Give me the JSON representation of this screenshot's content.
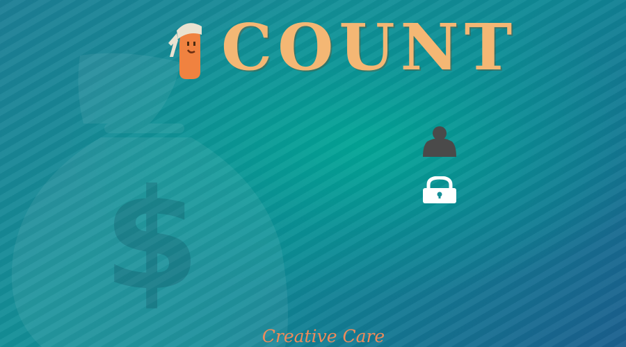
{
  "app": {
    "logo_text": "COUNT",
    "footer_text": "Creative Care"
  },
  "icons": {
    "background": "money-bag-dollar-icon",
    "mascot": "bandana-head-icon",
    "user": "user-icon",
    "lock": "lock-icon"
  },
  "colors": {
    "background": "#148f98",
    "logo_text": "#f4b774",
    "mascot": "#f08240",
    "footer": "#f08a5a",
    "user_icon": "#4a4a4a",
    "lock_icon": "#ffffff"
  }
}
